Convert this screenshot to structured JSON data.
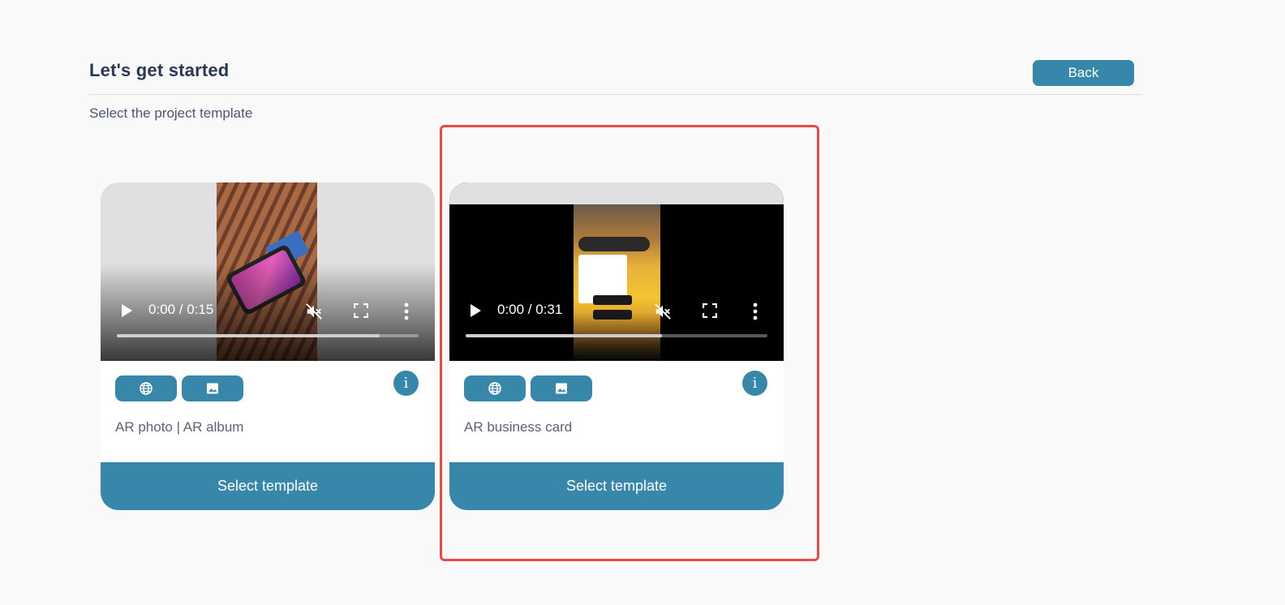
{
  "header": {
    "title": "Let's get started",
    "back_label": "Back",
    "subtitle": "Select the project template"
  },
  "colors": {
    "accent": "#3787ab",
    "highlight": "#e94b42",
    "title": "#2a3756"
  },
  "templates": [
    {
      "name": "AR photo | AR album",
      "video_time": "0:00 / 0:15",
      "progress": 0.87,
      "tags": [
        "globe-icon",
        "image-icon"
      ],
      "select_label": "Select template"
    },
    {
      "name": "AR business card",
      "video_time": "0:00 / 0:31",
      "progress": 0.65,
      "tags": [
        "globe-icon",
        "image-icon"
      ],
      "select_label": "Select template"
    }
  ]
}
